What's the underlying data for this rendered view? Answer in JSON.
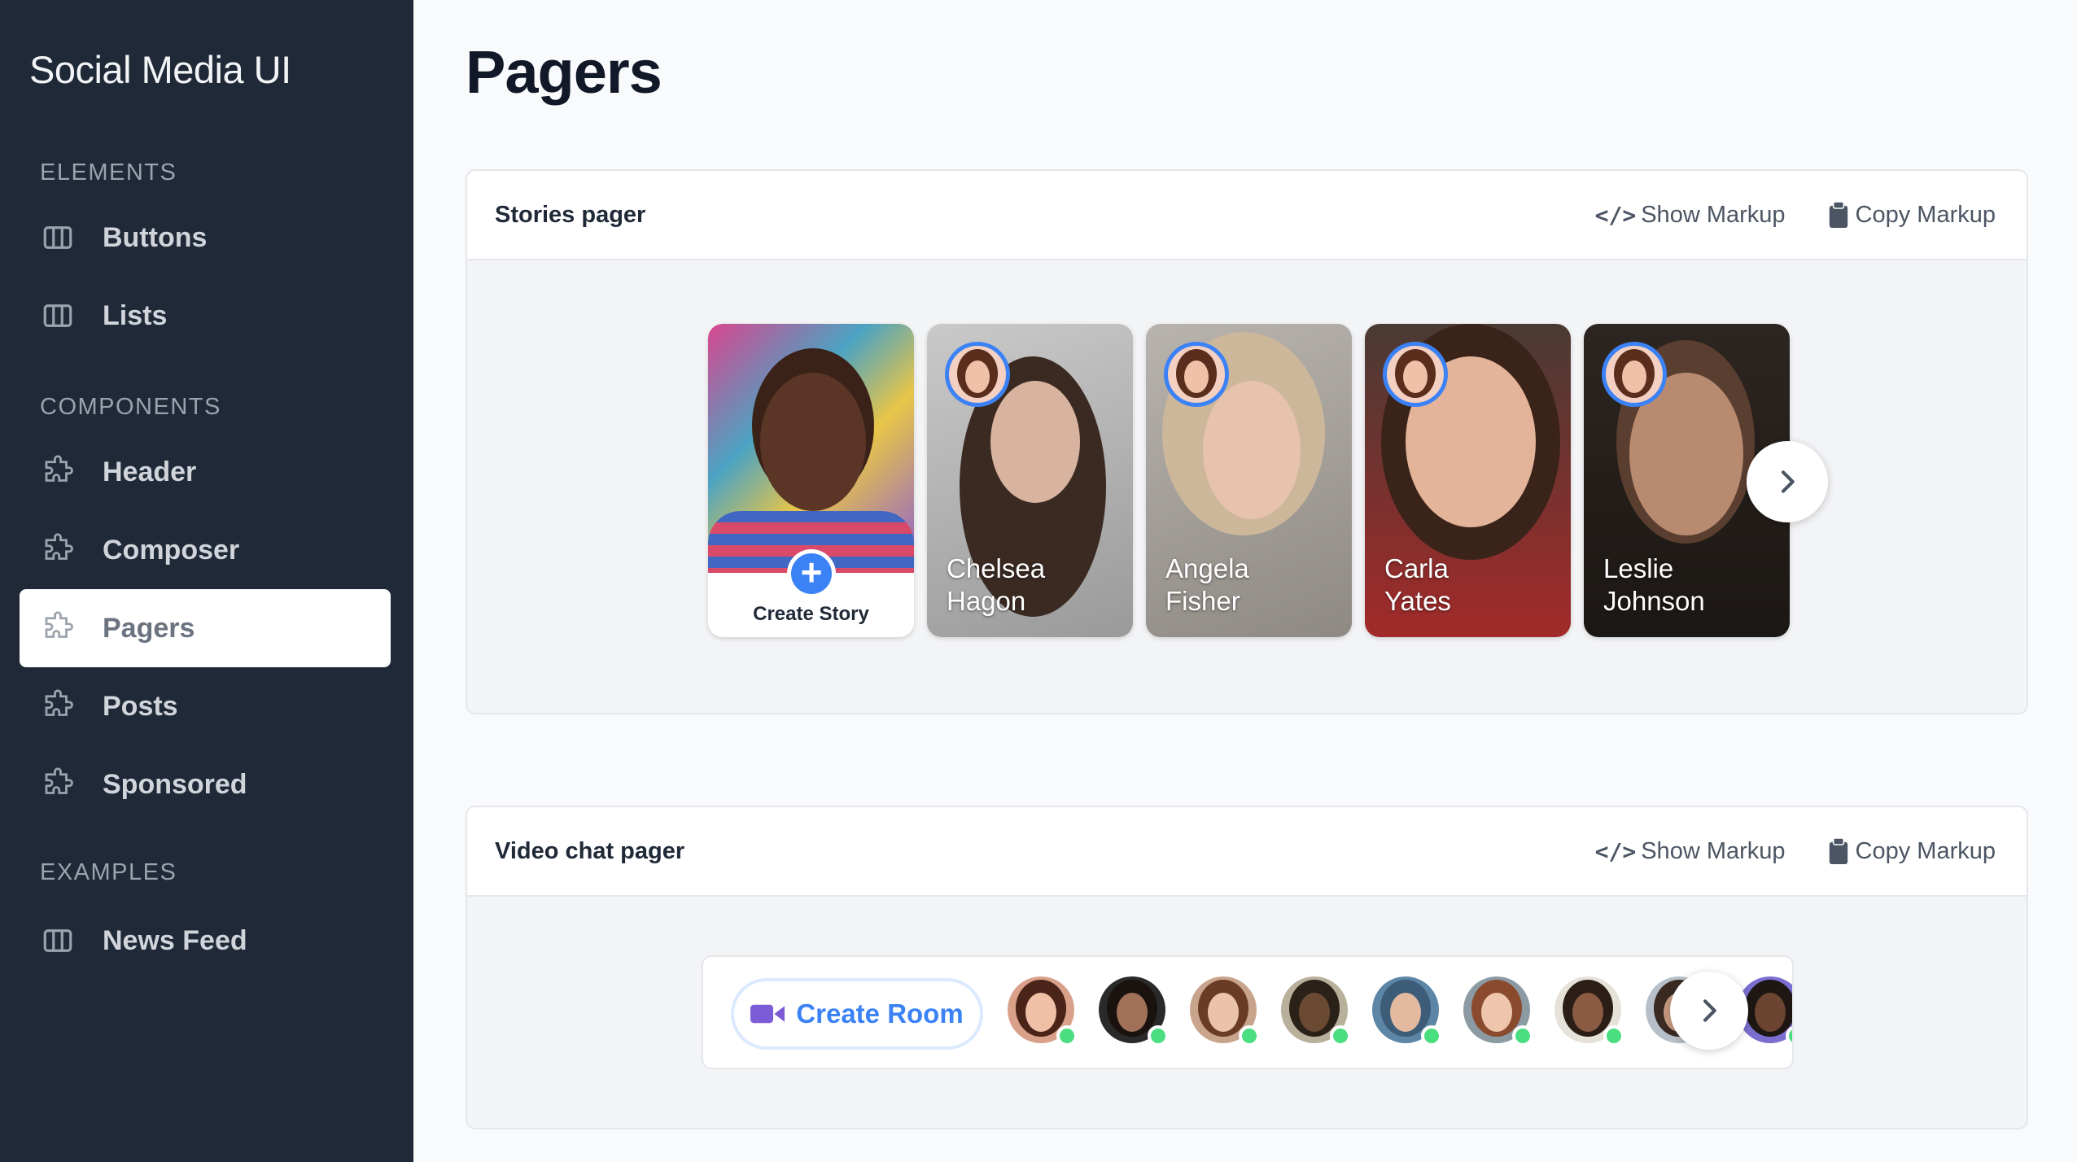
{
  "sidebar": {
    "brand": "Social Media UI",
    "sections": [
      {
        "title": "Elements",
        "items": [
          {
            "label": "Buttons",
            "icon": "columns-icon"
          },
          {
            "label": "Lists",
            "icon": "columns-icon"
          }
        ]
      },
      {
        "title": "Components",
        "items": [
          {
            "label": "Header",
            "icon": "puzzle-icon"
          },
          {
            "label": "Composer",
            "icon": "puzzle-icon"
          },
          {
            "label": "Pagers",
            "icon": "puzzle-icon",
            "active": true
          },
          {
            "label": "Posts",
            "icon": "puzzle-icon"
          },
          {
            "label": "Sponsored",
            "icon": "puzzle-icon"
          }
        ]
      },
      {
        "title": "Examples",
        "items": [
          {
            "label": "News Feed",
            "icon": "columns-icon"
          }
        ]
      }
    ]
  },
  "page": {
    "title": "Pagers"
  },
  "cards": [
    {
      "title": "Stories pager",
      "show_markup": "Show Markup",
      "copy_markup": "Copy Markup",
      "show_glyph": "</>"
    },
    {
      "title": "Video chat pager",
      "show_markup": "Show Markup",
      "copy_markup": "Copy Markup",
      "show_glyph": "</>"
    }
  ],
  "stories": {
    "create_label": "Create Story",
    "plus_glyph": "+",
    "items": [
      {
        "first": "Chelsea",
        "last": "Hagon"
      },
      {
        "first": "Angela",
        "last": "Fisher"
      },
      {
        "first": "Carla",
        "last": "Yates"
      },
      {
        "first": "Leslie",
        "last": "Johnson"
      }
    ]
  },
  "video_chat": {
    "create_room_label": "Create Room"
  },
  "colors": {
    "sidebar_bg": "#1f2937",
    "accent": "#3b82f6",
    "online": "#4ade80",
    "room_icon": "#7c5cd6"
  }
}
